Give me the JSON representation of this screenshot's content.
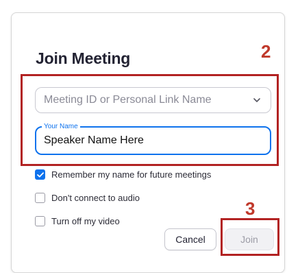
{
  "dialog": {
    "title": "Join Meeting"
  },
  "callouts": {
    "inputs_step": "2",
    "join_step": "3"
  },
  "meeting_id": {
    "placeholder": "Meeting ID or Personal Link Name",
    "value": "",
    "icon": "chevron-down-icon"
  },
  "your_name": {
    "label": "Your Name",
    "value": "Speaker Name Here"
  },
  "options": [
    {
      "label": "Remember my name for future meetings",
      "checked": true
    },
    {
      "label": "Don't connect to audio",
      "checked": false
    },
    {
      "label": "Turn off my video",
      "checked": false
    }
  ],
  "buttons": {
    "cancel_label": "Cancel",
    "join_label": "Join",
    "join_enabled": false
  },
  "colors": {
    "accent": "#0e72ed",
    "callout": "#c0392b",
    "highlight_border": "#b22222",
    "title_text": "#232333"
  }
}
